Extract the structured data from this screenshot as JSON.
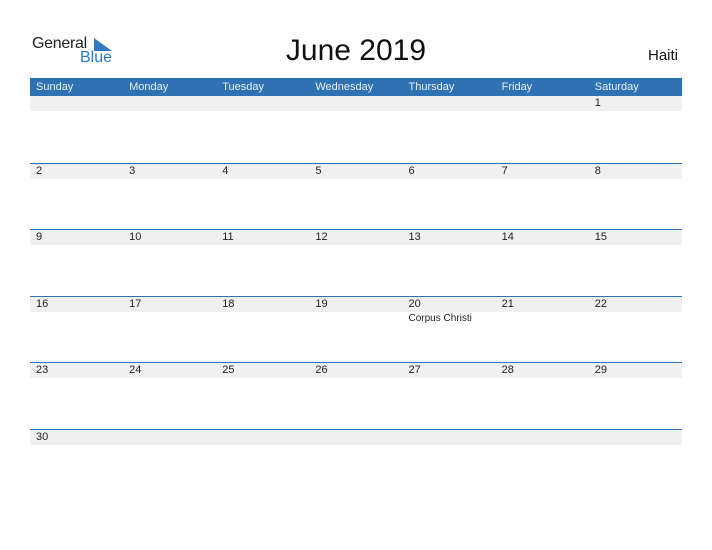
{
  "logo": {
    "general": "General",
    "blue": "Blue"
  },
  "title": "June 2019",
  "country": "Haiti",
  "colors": {
    "header": "#2f72b3",
    "accent": "#2f78c4"
  },
  "weekdays": [
    "Sunday",
    "Monday",
    "Tuesday",
    "Wednesday",
    "Thursday",
    "Friday",
    "Saturday"
  ],
  "weeks": [
    [
      {
        "d": ""
      },
      {
        "d": ""
      },
      {
        "d": ""
      },
      {
        "d": ""
      },
      {
        "d": ""
      },
      {
        "d": ""
      },
      {
        "d": "1"
      }
    ],
    [
      {
        "d": "2"
      },
      {
        "d": "3"
      },
      {
        "d": "4"
      },
      {
        "d": "5"
      },
      {
        "d": "6"
      },
      {
        "d": "7"
      },
      {
        "d": "8"
      }
    ],
    [
      {
        "d": "9"
      },
      {
        "d": "10"
      },
      {
        "d": "11"
      },
      {
        "d": "12"
      },
      {
        "d": "13"
      },
      {
        "d": "14"
      },
      {
        "d": "15"
      }
    ],
    [
      {
        "d": "16"
      },
      {
        "d": "17"
      },
      {
        "d": "18"
      },
      {
        "d": "19"
      },
      {
        "d": "20",
        "h": "Corpus Christi"
      },
      {
        "d": "21"
      },
      {
        "d": "22"
      }
    ],
    [
      {
        "d": "23"
      },
      {
        "d": "24"
      },
      {
        "d": "25"
      },
      {
        "d": "26"
      },
      {
        "d": "27"
      },
      {
        "d": "28"
      },
      {
        "d": "29"
      }
    ],
    [
      {
        "d": "30"
      },
      {
        "d": ""
      },
      {
        "d": ""
      },
      {
        "d": ""
      },
      {
        "d": ""
      },
      {
        "d": ""
      },
      {
        "d": ""
      }
    ]
  ]
}
